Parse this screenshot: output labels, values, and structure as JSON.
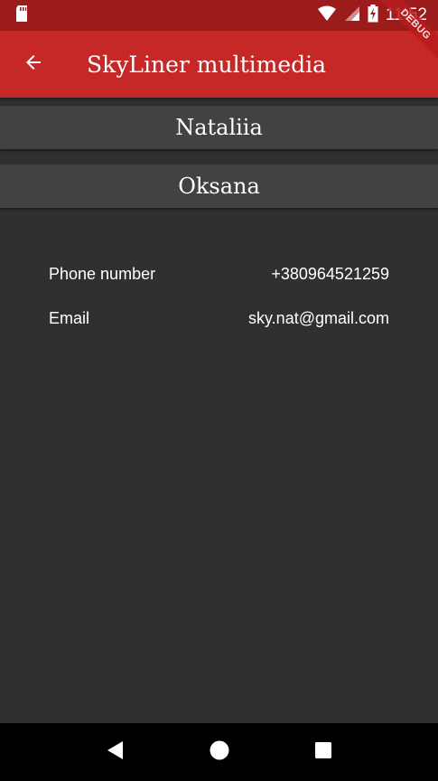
{
  "status_bar": {
    "time": "11:52",
    "icons": [
      "sd-card-icon",
      "wifi-icon",
      "cell-signal-icon",
      "battery-charging-icon"
    ]
  },
  "app_bar": {
    "title": "SkyLiner multimedia",
    "back_icon": "arrow-back-icon",
    "color": "#c62828"
  },
  "debug_banner": "DEBUG",
  "people": [
    {
      "name": "Nataliia"
    },
    {
      "name": "Oksana"
    }
  ],
  "details": {
    "phone_label": "Phone number",
    "phone_value": "+380964521259",
    "email_label": "Email",
    "email_value": "sky.nat@gmail.com"
  },
  "nav_bar": {
    "icons": [
      "back-triangle-icon",
      "home-circle-icon",
      "recents-square-icon"
    ]
  },
  "colors": {
    "background": "#303030",
    "card": "#424242",
    "status_bar": "#9c1c1c"
  }
}
